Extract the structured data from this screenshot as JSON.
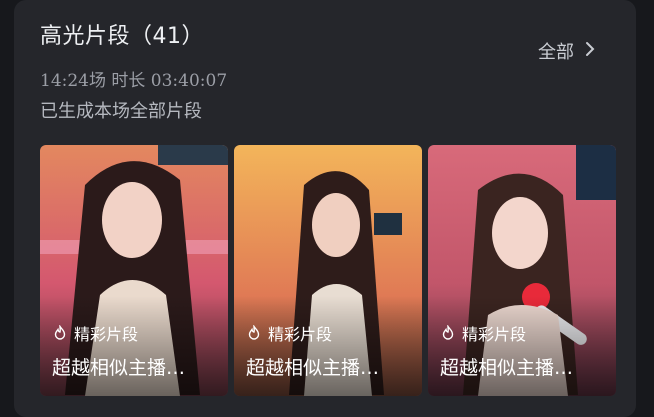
{
  "section": {
    "title": "高光片段（41）",
    "see_all_label": "全部",
    "meta": "14:24场 时长 03:40:07",
    "status": "已生成本场全部片段"
  },
  "clips": [
    {
      "tag": "精彩片段",
      "caption": "超越相似主播…"
    },
    {
      "tag": "精彩片段",
      "caption": "超越相似主播…"
    },
    {
      "tag": "精彩片段",
      "caption": "超越相似主播…"
    }
  ],
  "icons": {
    "see_all": "chevron-right-icon",
    "tag": "flame-icon"
  }
}
